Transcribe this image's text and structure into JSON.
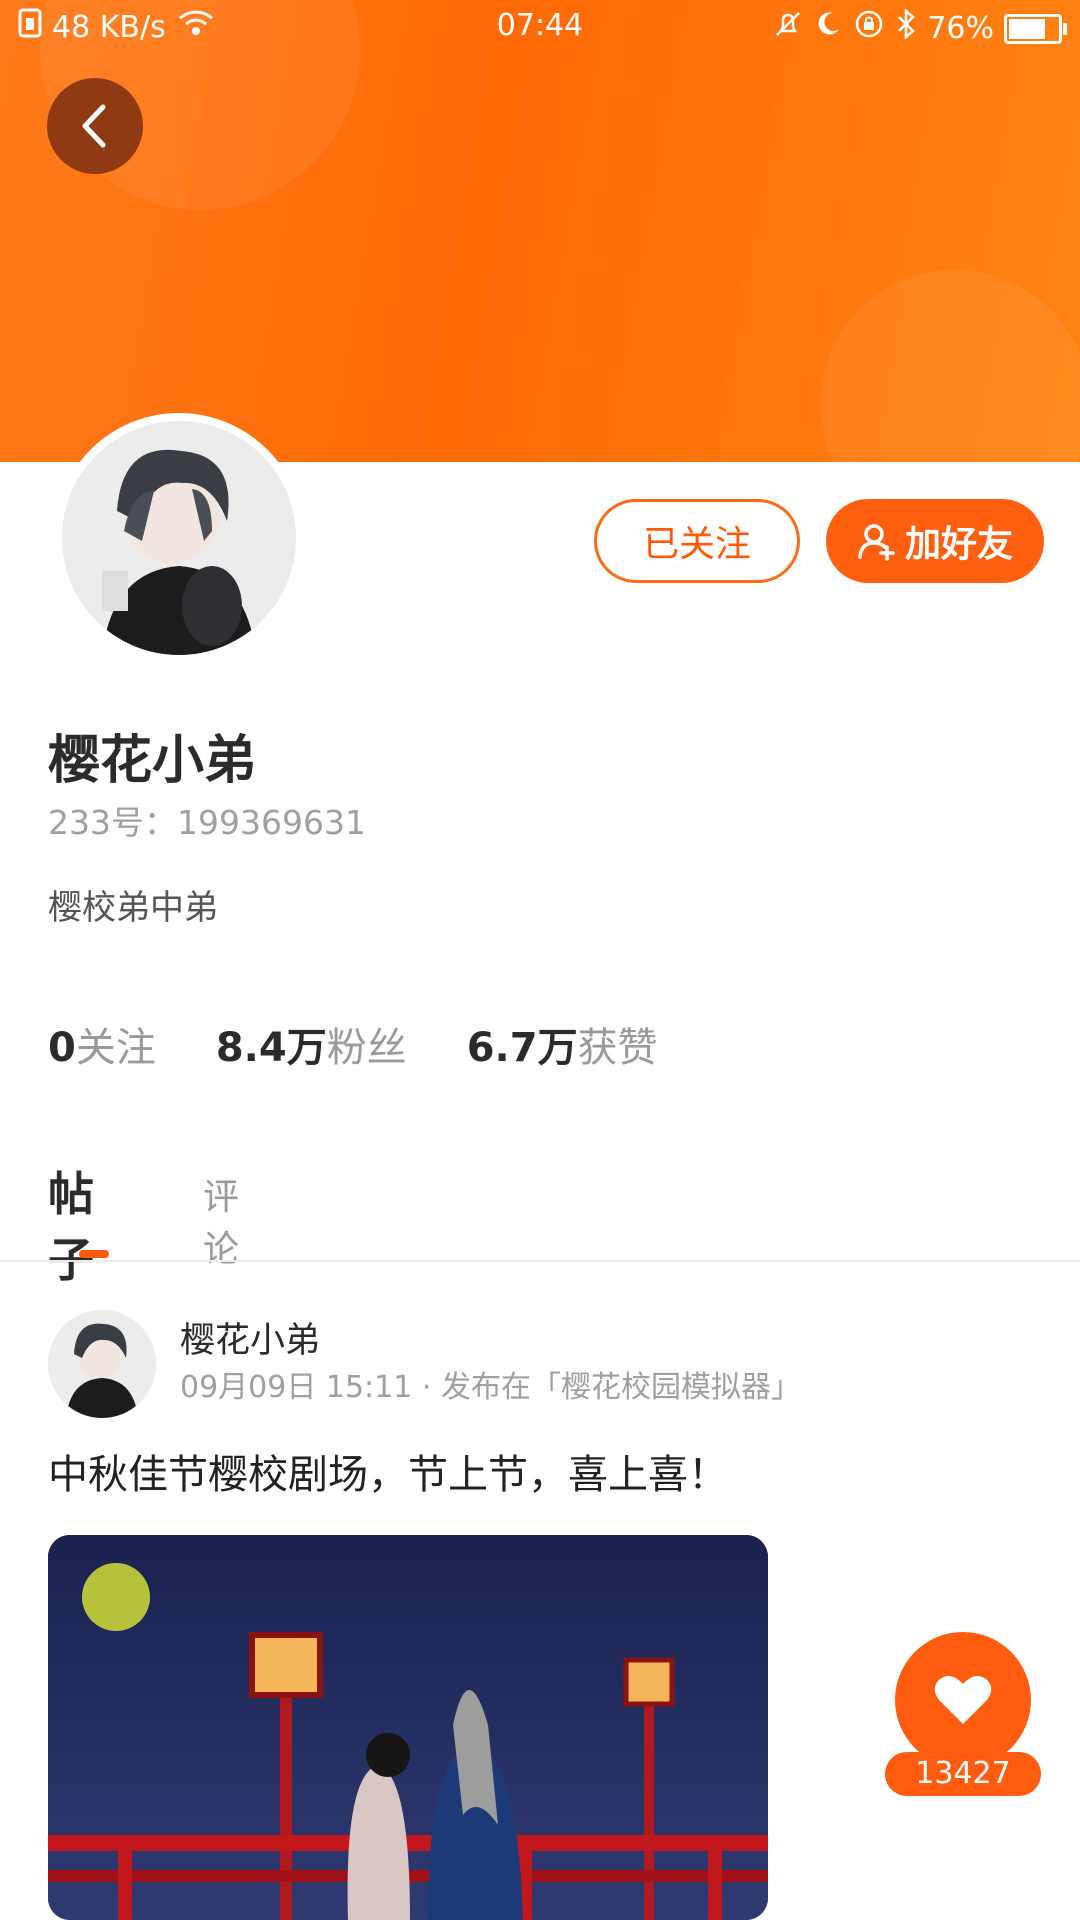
{
  "status_bar": {
    "speed": "48 KB/s",
    "time": "07:44",
    "battery": "76%"
  },
  "profile": {
    "name": "樱花小弟",
    "id_line": "233号：199369631",
    "bio": "樱校弟中弟",
    "follow_button": "已关注",
    "add_friend_button": "加好友"
  },
  "stats": [
    {
      "num": "0",
      "label": "关注"
    },
    {
      "num": "8.4万",
      "label": "粉丝"
    },
    {
      "num": "6.7万",
      "label": "获赞"
    }
  ],
  "tabs": {
    "active": "帖子",
    "other": "评论"
  },
  "post": {
    "author": "樱花小弟",
    "meta": "09月09日 15:11 · 发布在「樱花校园模拟器」",
    "text": "中秋佳节樱校剧场，节上节，喜上喜！",
    "likes": "13427"
  },
  "colors": {
    "accent": "#ff6010",
    "banner": "#ff7a1a"
  }
}
